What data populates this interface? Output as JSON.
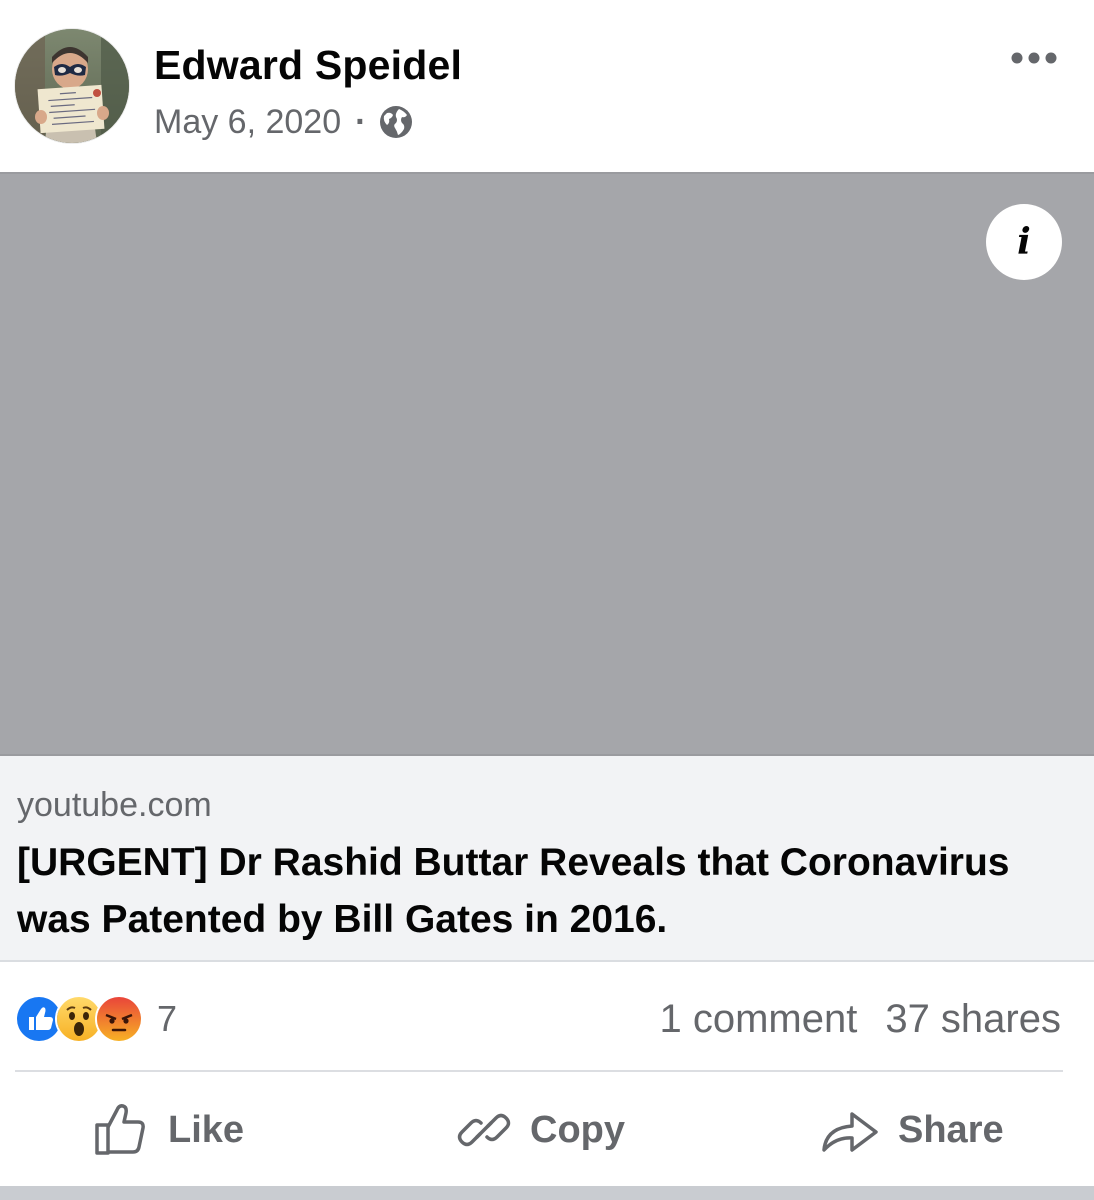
{
  "post": {
    "author": "Edward Speidel",
    "date": "May 6, 2020",
    "separator": "·",
    "privacy_icon": "globe-icon",
    "more_icon": "more-horizontal-icon"
  },
  "media": {
    "info_glyph": "i"
  },
  "link": {
    "domain": "youtube.com",
    "title": "[URGENT] Dr Rashid Buttar Reveals that Coronavirus was Patented by Bill Gates in 2016."
  },
  "stats": {
    "reactions": [
      "like",
      "wow",
      "angry"
    ],
    "reaction_count": "7",
    "comments": "1 comment",
    "shares": "37 shares"
  },
  "actions": {
    "like_label": "Like",
    "copy_label": "Copy",
    "share_label": "Share"
  },
  "colors": {
    "secondary_text": "#65676b",
    "media_placeholder": "#a5a6aa",
    "link_card_bg": "#f2f3f5",
    "like_blue": "#1877f2",
    "angry_red": "#e9710f"
  }
}
